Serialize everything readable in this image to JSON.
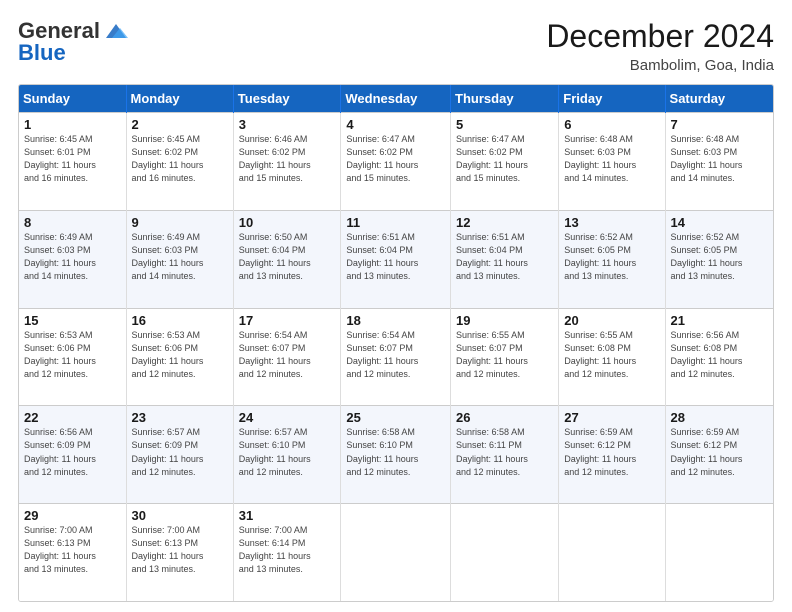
{
  "header": {
    "logo_general": "General",
    "logo_blue": "Blue",
    "month_title": "December 2024",
    "location": "Bambolim, Goa, India"
  },
  "days_of_week": [
    "Sunday",
    "Monday",
    "Tuesday",
    "Wednesday",
    "Thursday",
    "Friday",
    "Saturday"
  ],
  "weeks": [
    [
      {
        "day": "1",
        "sunrise": "6:45 AM",
        "sunset": "6:01 PM",
        "daylight": "11 hours and 16 minutes."
      },
      {
        "day": "2",
        "sunrise": "6:45 AM",
        "sunset": "6:02 PM",
        "daylight": "11 hours and 16 minutes."
      },
      {
        "day": "3",
        "sunrise": "6:46 AM",
        "sunset": "6:02 PM",
        "daylight": "11 hours and 15 minutes."
      },
      {
        "day": "4",
        "sunrise": "6:47 AM",
        "sunset": "6:02 PM",
        "daylight": "11 hours and 15 minutes."
      },
      {
        "day": "5",
        "sunrise": "6:47 AM",
        "sunset": "6:02 PM",
        "daylight": "11 hours and 15 minutes."
      },
      {
        "day": "6",
        "sunrise": "6:48 AM",
        "sunset": "6:03 PM",
        "daylight": "11 hours and 14 minutes."
      },
      {
        "day": "7",
        "sunrise": "6:48 AM",
        "sunset": "6:03 PM",
        "daylight": "11 hours and 14 minutes."
      }
    ],
    [
      {
        "day": "8",
        "sunrise": "6:49 AM",
        "sunset": "6:03 PM",
        "daylight": "11 hours and 14 minutes."
      },
      {
        "day": "9",
        "sunrise": "6:49 AM",
        "sunset": "6:03 PM",
        "daylight": "11 hours and 14 minutes."
      },
      {
        "day": "10",
        "sunrise": "6:50 AM",
        "sunset": "6:04 PM",
        "daylight": "11 hours and 13 minutes."
      },
      {
        "day": "11",
        "sunrise": "6:51 AM",
        "sunset": "6:04 PM",
        "daylight": "11 hours and 13 minutes."
      },
      {
        "day": "12",
        "sunrise": "6:51 AM",
        "sunset": "6:04 PM",
        "daylight": "11 hours and 13 minutes."
      },
      {
        "day": "13",
        "sunrise": "6:52 AM",
        "sunset": "6:05 PM",
        "daylight": "11 hours and 13 minutes."
      },
      {
        "day": "14",
        "sunrise": "6:52 AM",
        "sunset": "6:05 PM",
        "daylight": "11 hours and 13 minutes."
      }
    ],
    [
      {
        "day": "15",
        "sunrise": "6:53 AM",
        "sunset": "6:06 PM",
        "daylight": "11 hours and 12 minutes."
      },
      {
        "day": "16",
        "sunrise": "6:53 AM",
        "sunset": "6:06 PM",
        "daylight": "11 hours and 12 minutes."
      },
      {
        "day": "17",
        "sunrise": "6:54 AM",
        "sunset": "6:07 PM",
        "daylight": "11 hours and 12 minutes."
      },
      {
        "day": "18",
        "sunrise": "6:54 AM",
        "sunset": "6:07 PM",
        "daylight": "11 hours and 12 minutes."
      },
      {
        "day": "19",
        "sunrise": "6:55 AM",
        "sunset": "6:07 PM",
        "daylight": "11 hours and 12 minutes."
      },
      {
        "day": "20",
        "sunrise": "6:55 AM",
        "sunset": "6:08 PM",
        "daylight": "11 hours and 12 minutes."
      },
      {
        "day": "21",
        "sunrise": "6:56 AM",
        "sunset": "6:08 PM",
        "daylight": "11 hours and 12 minutes."
      }
    ],
    [
      {
        "day": "22",
        "sunrise": "6:56 AM",
        "sunset": "6:09 PM",
        "daylight": "11 hours and 12 minutes."
      },
      {
        "day": "23",
        "sunrise": "6:57 AM",
        "sunset": "6:09 PM",
        "daylight": "11 hours and 12 minutes."
      },
      {
        "day": "24",
        "sunrise": "6:57 AM",
        "sunset": "6:10 PM",
        "daylight": "11 hours and 12 minutes."
      },
      {
        "day": "25",
        "sunrise": "6:58 AM",
        "sunset": "6:10 PM",
        "daylight": "11 hours and 12 minutes."
      },
      {
        "day": "26",
        "sunrise": "6:58 AM",
        "sunset": "6:11 PM",
        "daylight": "11 hours and 12 minutes."
      },
      {
        "day": "27",
        "sunrise": "6:59 AM",
        "sunset": "6:12 PM",
        "daylight": "11 hours and 12 minutes."
      },
      {
        "day": "28",
        "sunrise": "6:59 AM",
        "sunset": "6:12 PM",
        "daylight": "11 hours and 12 minutes."
      }
    ],
    [
      {
        "day": "29",
        "sunrise": "7:00 AM",
        "sunset": "6:13 PM",
        "daylight": "11 hours and 13 minutes."
      },
      {
        "day": "30",
        "sunrise": "7:00 AM",
        "sunset": "6:13 PM",
        "daylight": "11 hours and 13 minutes."
      },
      {
        "day": "31",
        "sunrise": "7:00 AM",
        "sunset": "6:14 PM",
        "daylight": "11 hours and 13 minutes."
      },
      null,
      null,
      null,
      null
    ]
  ],
  "labels": {
    "sunrise": "Sunrise: ",
    "sunset": "Sunset: ",
    "daylight": "Daylight: "
  }
}
